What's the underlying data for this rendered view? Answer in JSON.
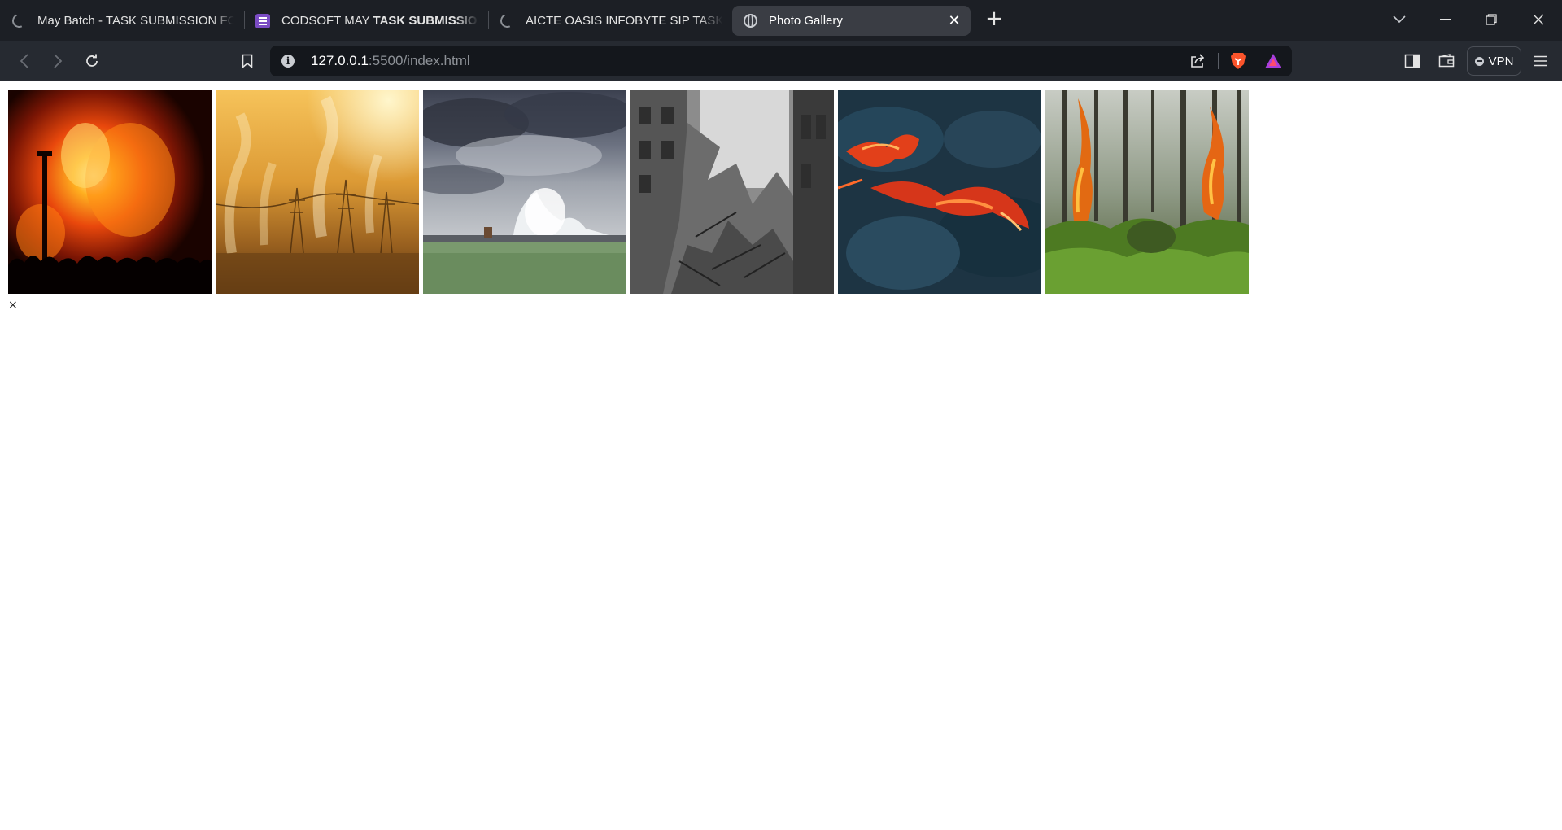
{
  "browser": {
    "tabs": [
      {
        "title": "May Batch - TASK SUBMISSION FORM",
        "favicon": "loading-spinner-icon",
        "active": false
      },
      {
        "title_plain": "CODSOFT MAY ",
        "title_bold": "TASK SUBMISSION FORM",
        "favicon": "google-forms-icon",
        "active": false
      },
      {
        "title": "AICTE OASIS INFOBYTE SIP TASK LIST",
        "favicon": "loading-spinner-icon",
        "active": false
      },
      {
        "title": "Photo Gallery",
        "favicon": "globe-icon",
        "active": true
      }
    ],
    "address_bar": {
      "host": "127.0.0.1",
      "rest": ":5500/index.html"
    },
    "vpn_label": "VPN"
  },
  "page": {
    "title": "Photo Gallery",
    "photos": [
      {
        "alt": "Burning building at night",
        "theme": "fire-night"
      },
      {
        "alt": "Smoking factories at sunset",
        "theme": "pollution"
      },
      {
        "alt": "Storm waves crashing on pier",
        "theme": "storm"
      },
      {
        "alt": "Destroyed buildings rubble",
        "theme": "rubble"
      },
      {
        "alt": "Molten lava flow",
        "theme": "lava"
      },
      {
        "alt": "Forest fire",
        "theme": "forest-fire"
      }
    ],
    "close_glyph": "×"
  },
  "colors": {
    "tabstrip": "#1c1f25",
    "toolbar": "#262a31",
    "omnibox": "#14171c",
    "active_tab": "#3a3d44",
    "brave_orange": "#fb542b"
  }
}
